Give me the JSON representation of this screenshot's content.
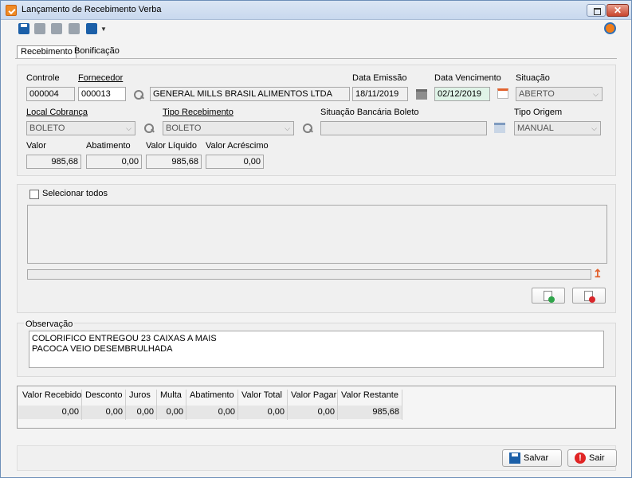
{
  "window": {
    "title": "Lançamento de Recebimento Verba",
    "close_glyph": "✕"
  },
  "tabs": [
    "Recebimento",
    "Bonificação"
  ],
  "form": {
    "controle_label": "Controle",
    "controle_value": "000004",
    "fornecedor_label": "Fornecedor",
    "fornecedor_code": "000013",
    "fornecedor_name": "GENERAL MILLS BRASIL ALIMENTOS LTDA",
    "data_emissao_label": "Data Emissão",
    "data_emissao_value": "18/11/2019",
    "data_vencimento_label": "Data Vencimento",
    "data_vencimento_value": "02/12/2019",
    "situacao_label": "Situação",
    "situacao_value": "ABERTO",
    "local_cobranca_label": "Local Cobrança",
    "local_cobranca_value": "BOLETO",
    "tipo_recebimento_label": "Tipo Recebimento",
    "tipo_recebimento_value": "BOLETO",
    "situacao_bancaria_label": "Situação Bancária Boleto",
    "situacao_bancaria_value": "",
    "tipo_origem_label": "Tipo Origem",
    "tipo_origem_value": "MANUAL",
    "valor_label": "Valor",
    "valor_value": "985,68",
    "abatimento_label": "Abatimento",
    "abatimento_value": "0,00",
    "valor_liquido_label": "Valor Líquido",
    "valor_liquido_value": "985,68",
    "valor_acrescimo_label": "Valor Acréscimo",
    "valor_acrescimo_value": "0,00"
  },
  "list": {
    "select_all_label": "Selecionar todos"
  },
  "observacao": {
    "label": "Observação",
    "text": "COLORIFICO ENTREGOU 23 CAIXAS A MAIS\nPACOCA VEIO DESEMBRULHADA"
  },
  "totals": {
    "headers": [
      "Valor Recebido",
      "Desconto",
      "Juros",
      "Multa",
      "Abatimento",
      "Valor Total",
      "Valor Pagar",
      "Valor Restante"
    ],
    "values": [
      "0,00",
      "0,00",
      "0,00",
      "0,00",
      "0,00",
      "0,00",
      "0,00",
      "985,68"
    ]
  },
  "footer": {
    "save_label": "Salvar",
    "exit_label": "Sair"
  },
  "icons": {
    "exit_glyph": "!",
    "combo_arrow": "⌵",
    "up_arrow": "↥"
  },
  "colors": {
    "accent_orange": "#e2622e",
    "due_date_bg": "#dff3e7",
    "save_blue": "#1b5fa8",
    "exit_red": "#e02424"
  }
}
